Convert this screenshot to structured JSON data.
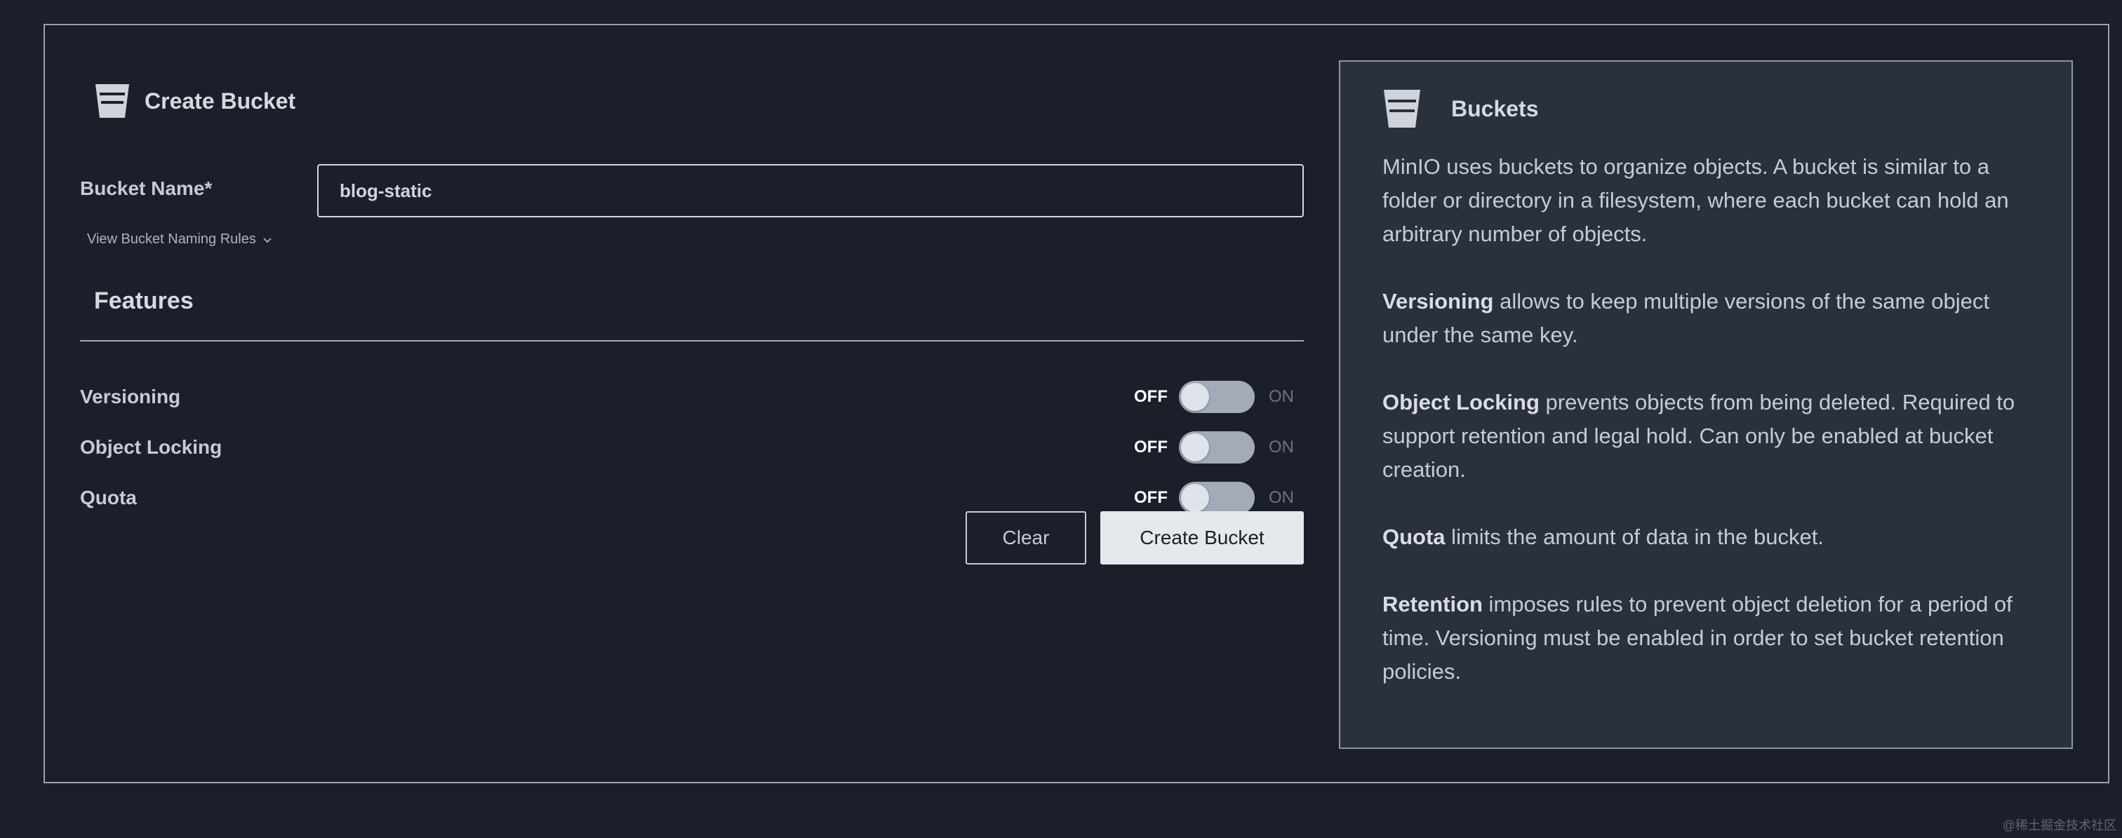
{
  "page": {
    "title": "Create Bucket"
  },
  "form": {
    "name_label": "Bucket Name*",
    "name_value": "blog-static",
    "rules_link": "View Bucket Naming Rules",
    "features_title": "Features",
    "features": [
      {
        "label": "Versioning",
        "off_label": "OFF",
        "on_label": "ON",
        "enabled": false
      },
      {
        "label": "Object Locking",
        "off_label": "OFF",
        "on_label": "ON",
        "enabled": false
      },
      {
        "label": "Quota",
        "off_label": "OFF",
        "on_label": "ON",
        "enabled": false
      }
    ],
    "clear_label": "Clear",
    "create_label": "Create Bucket"
  },
  "info": {
    "title": "Buckets",
    "intro": "MinIO uses buckets to organize objects. A bucket is similar to a folder or directory in a filesystem, where each bucket can hold an arbitrary number of objects.",
    "items": [
      {
        "term": "Versioning",
        "text": " allows to keep multiple versions of the same object under the same key."
      },
      {
        "term": "Object Locking",
        "text": " prevents objects from being deleted. Required to support retention and legal hold. Can only be enabled at bucket creation."
      },
      {
        "term": "Quota",
        "text": " limits the amount of data in the bucket."
      },
      {
        "term": "Retention",
        "text": " imposes rules to prevent object deletion for a period of time. Versioning must be enabled in order to set bucket retention policies."
      }
    ]
  },
  "watermark": "@稀土掘金技术社区",
  "icons": {
    "bucket": "bucket-icon",
    "chevron": "chevron-down-icon"
  },
  "colors": {
    "background": "#1b1f29",
    "panel": "#2b303d",
    "primary_button": "#e6e9ec",
    "toggle_track": "#a4abb8"
  }
}
